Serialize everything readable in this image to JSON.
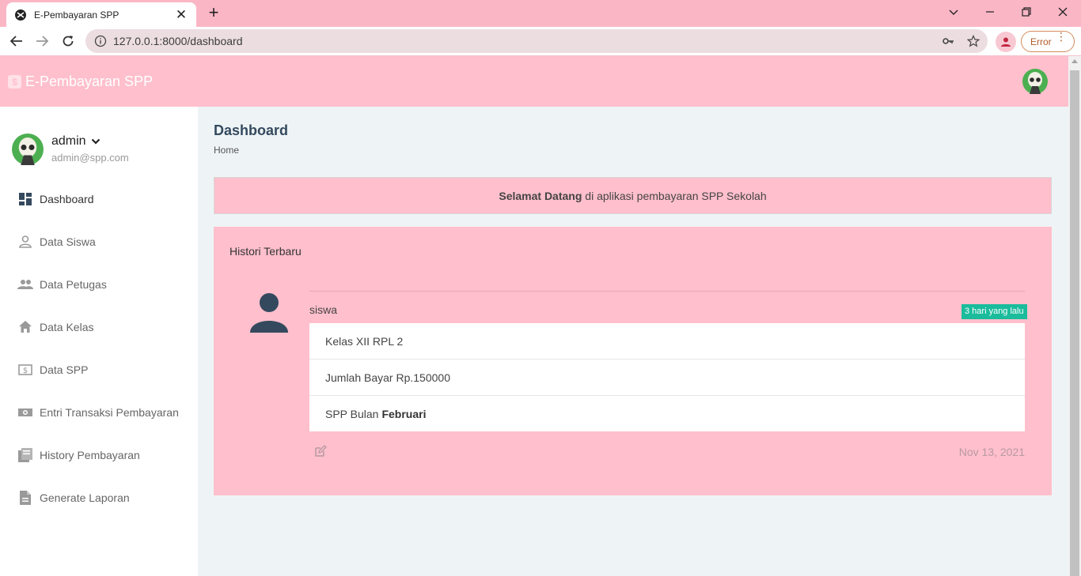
{
  "browser": {
    "tab_title": "E-Pembayaran SPP",
    "url": "127.0.0.1:8000/dashboard",
    "error_label": "Error"
  },
  "header": {
    "brand": "E-Pembayaran SPP",
    "brand_logo_glyph": "$"
  },
  "sidebar": {
    "user_name": "admin",
    "user_email": "admin@spp.com",
    "items": [
      {
        "label": "Dashboard",
        "icon": "dashboard-icon"
      },
      {
        "label": "Data Siswa",
        "icon": "person-icon"
      },
      {
        "label": "Data Petugas",
        "icon": "people-icon"
      },
      {
        "label": "Data Kelas",
        "icon": "home-icon"
      },
      {
        "label": "Data SPP",
        "icon": "dollar-box-icon"
      },
      {
        "label": "Entri Transaksi Pembayaran",
        "icon": "money-icon"
      },
      {
        "label": "History Pembayaran",
        "icon": "library-books-icon"
      },
      {
        "label": "Generate Laporan",
        "icon": "document-icon"
      }
    ]
  },
  "main": {
    "page_title": "Dashboard",
    "breadcrumb": "Home",
    "welcome_bold": "Selamat Datang",
    "welcome_rest": " di aplikasi pembayaran SPP Sekolah",
    "history": {
      "title": "Histori Terbaru",
      "user": "siswa",
      "badge": "3 hari yang lalu",
      "rows": {
        "kelas": "Kelas XII RPL 2",
        "jumlah": "Jumlah Bayar Rp.150000",
        "spp_prefix": "SPP Bulan",
        "spp_month": "Februari"
      },
      "date": "Nov 13, 2021"
    }
  },
  "colors": {
    "accent_pink": "#ffbfcc",
    "tab_strip": "#fbb6c6",
    "badge": "#1abc9c",
    "avatar_green": "#4caf50"
  }
}
